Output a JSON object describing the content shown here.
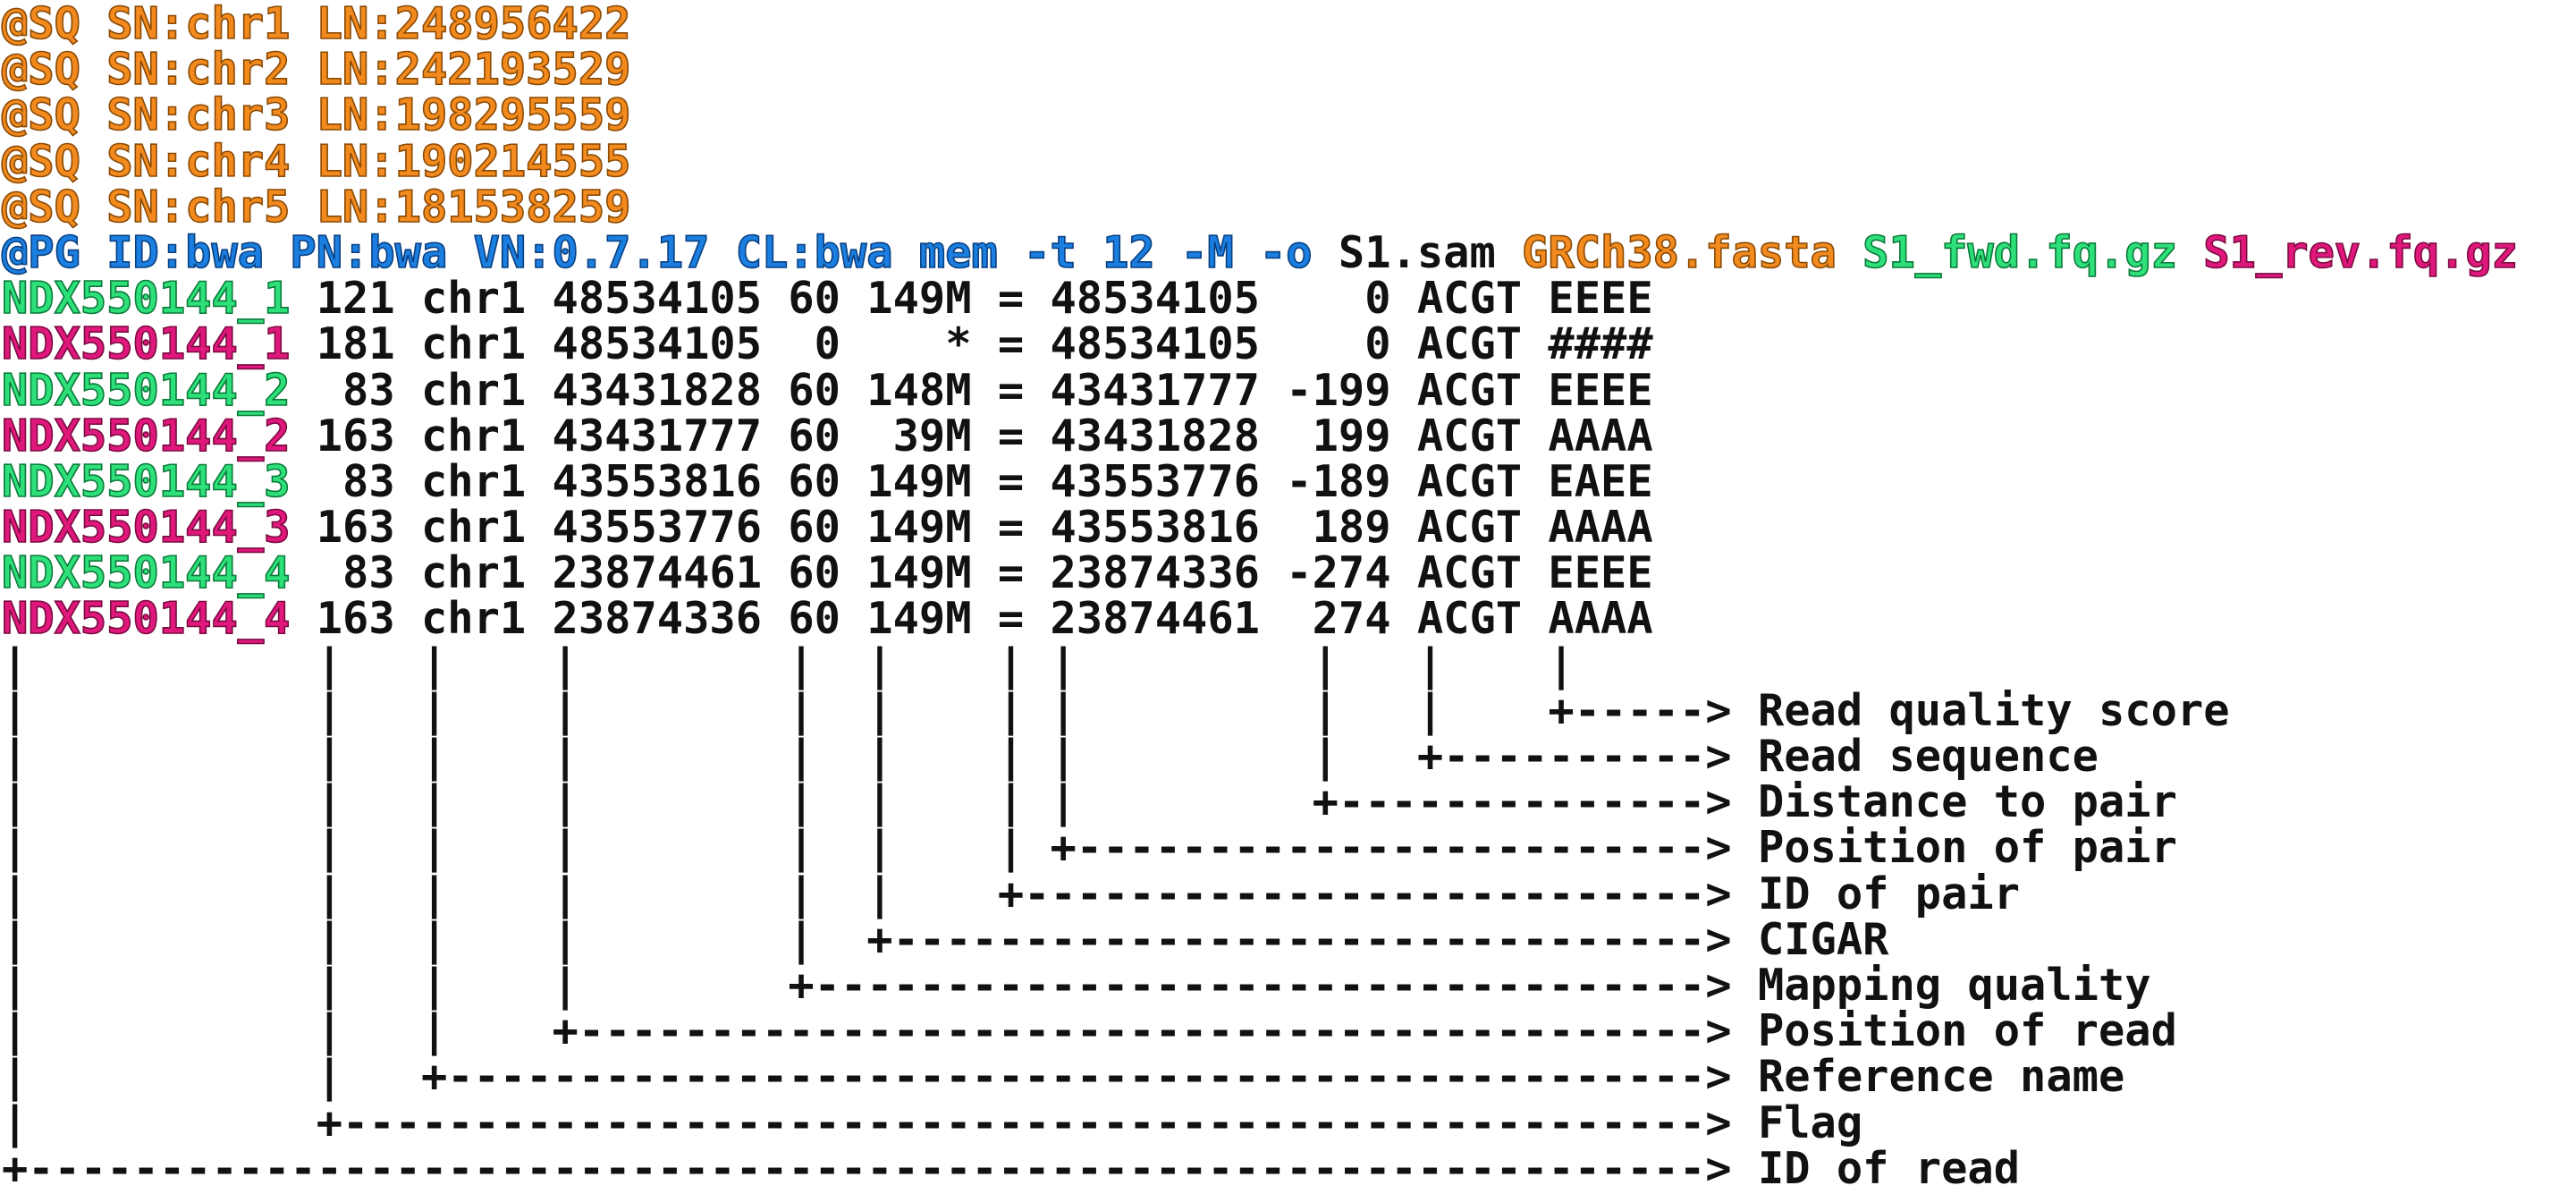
{
  "colors": {
    "header_sq": "#f28a1e",
    "header_pg": "#1a7fe0",
    "read_forward": "#2ee07a",
    "read_reverse": "#e0187c",
    "text": "#111111",
    "background": "#ffffff"
  },
  "header": {
    "sq_lines": [
      "@SQ SN:chr1 LN:248956422",
      "@SQ SN:chr2 LN:242193529",
      "@SQ SN:chr3 LN:198295559",
      "@SQ SN:chr4 LN:190214555",
      "@SQ SN:chr5 LN:181538259"
    ],
    "pg": {
      "command": "@PG ID:bwa PN:bwa VN:0.7.17 CL:bwa mem -t 12 -M -o",
      "output": " S1.sam",
      "reference": " GRCh38.fasta",
      "fwd_reads": " S1_fwd.fq.gz",
      "rev_reads": " S1_rev.fq.gz"
    }
  },
  "alignments": [
    {
      "qname": "NDX550144_1",
      "fields": " 121 chr1 48534105 60 149M = 48534105    0 ACGT EEEE"
    },
    {
      "qname": "NDX550144_1",
      "fields": " 181 chr1 48534105  0    * = 48534105    0 ACGT ####"
    },
    {
      "qname": "NDX550144_2",
      "fields": "  83 chr1 43431828 60 148M = 43431777 -199 ACGT EEEE"
    },
    {
      "qname": "NDX550144_2",
      "fields": " 163 chr1 43431777 60  39M = 43431828  199 ACGT AAAA"
    },
    {
      "qname": "NDX550144_3",
      "fields": "  83 chr1 43553816 60 149M = 43553776 -189 ACGT EAEE"
    },
    {
      "qname": "NDX550144_3",
      "fields": " 163 chr1 43553776 60 149M = 43553816  189 ACGT AAAA"
    },
    {
      "qname": "NDX550144_4",
      "fields": "  83 chr1 23874461 60 149M = 23874336 -274 ACGT EEEE"
    },
    {
      "qname": "NDX550144_4",
      "fields": " 163 chr1 23874336 60 149M = 23874461  274 ACGT AAAA"
    }
  ],
  "annotation": {
    "pointer_lines": [
      "|           |   |    |        |  |    | |         |   |    |",
      "|           |   |    |        |  |    | |         |   |    +-----> ",
      "|           |   |    |        |  |    | |         |   +----------> ",
      "|           |   |    |        |  |    | |         +--------------> ",
      "|           |   |    |        |  |    | +------------------------> ",
      "|           |   |    |        |  |    +--------------------------> ",
      "|           |   |    |        |  +-------------------------------> ",
      "|           |   |    |        +----------------------------------> ",
      "|           |   |    +-------------------------------------------> ",
      "|           |   +------------------------------------------------> ",
      "|           +----------------------------------------------------> ",
      "+----------------------------------------------------------------> "
    ],
    "labels": [
      "",
      "Read quality score",
      "Read sequence",
      "Distance to pair",
      "Position of pair",
      "ID of pair",
      "CIGAR",
      "Mapping quality",
      "Position of read",
      "Reference name",
      "Flag",
      "ID of read"
    ]
  }
}
